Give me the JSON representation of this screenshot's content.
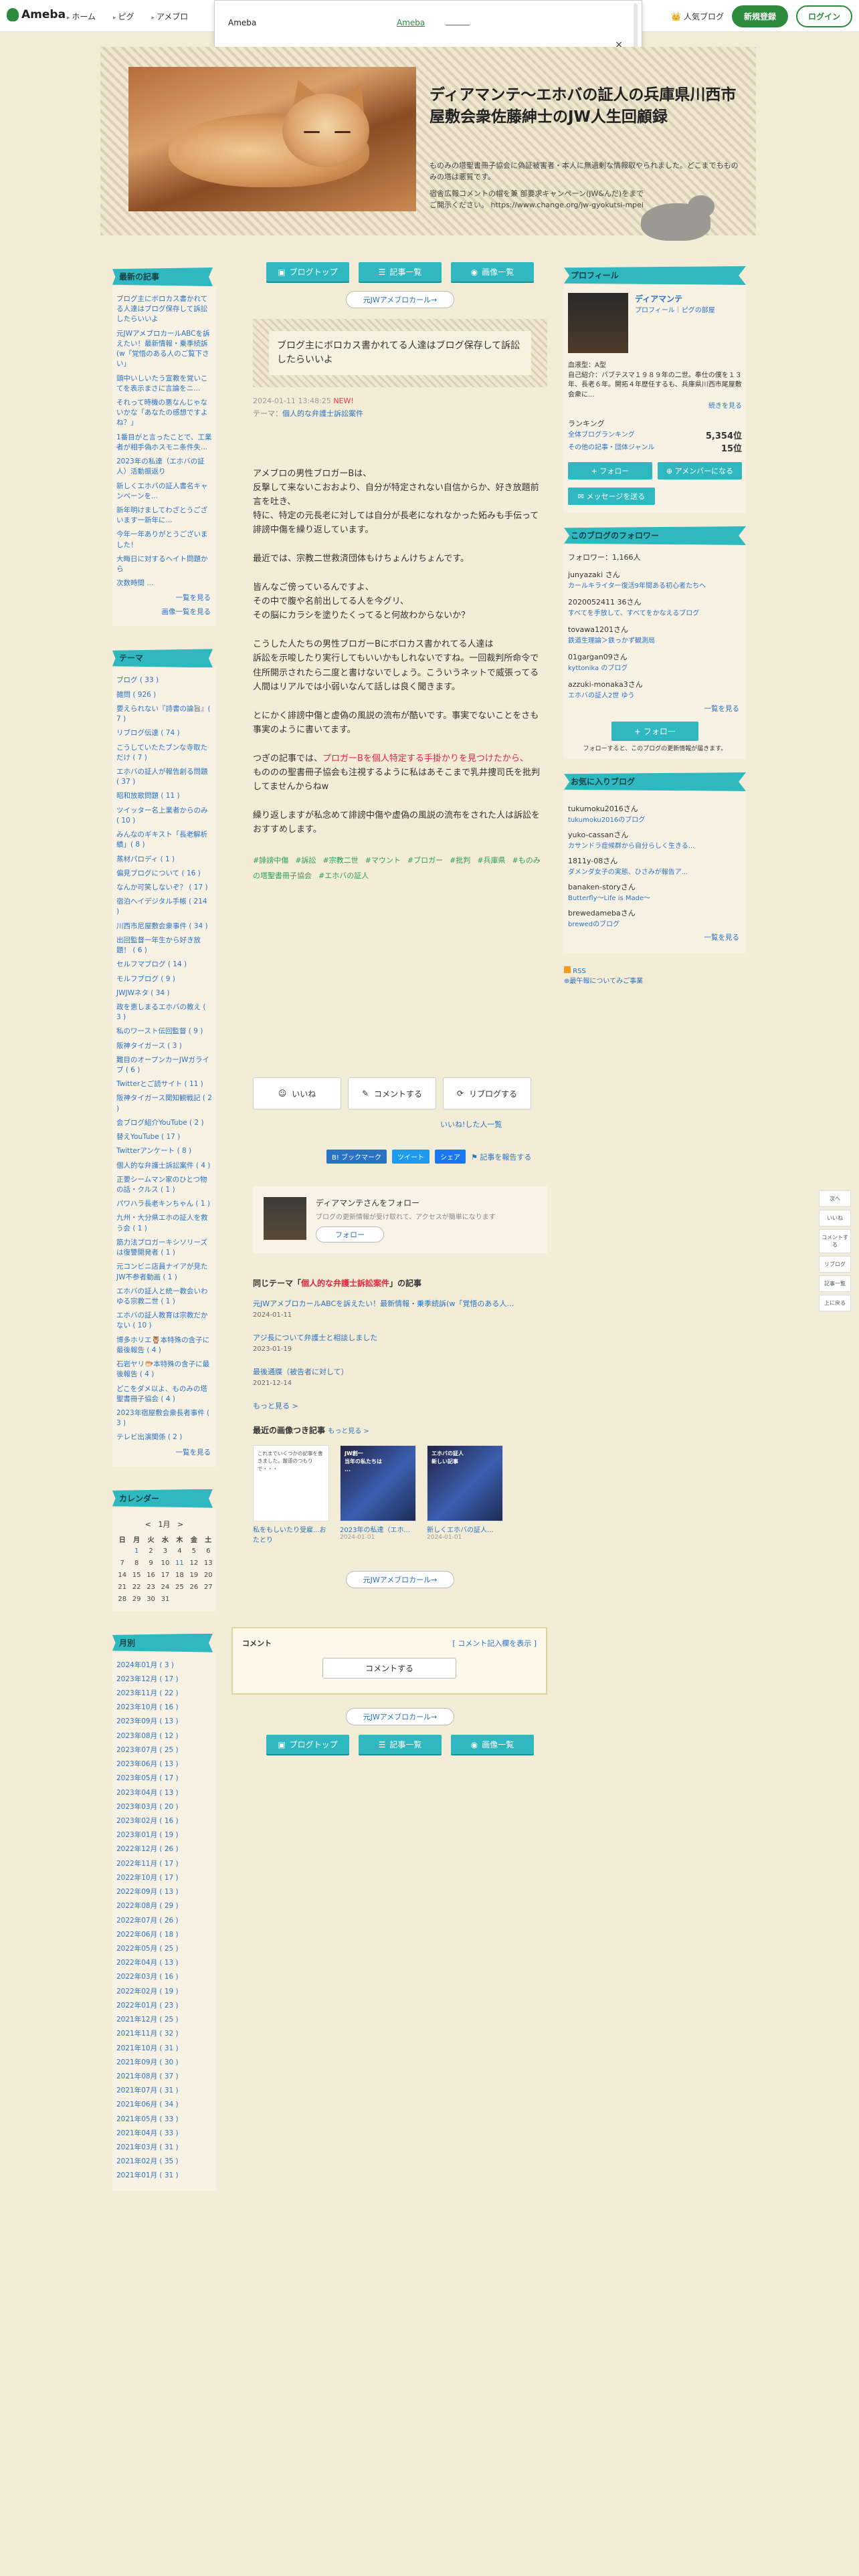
{
  "topbar": {
    "logo": "Ameba",
    "nav": [
      "ホーム",
      "ピグ",
      "アメブロ"
    ],
    "popular": "人気ブログ",
    "register": "新規登録",
    "login": "ログイン"
  },
  "popup": {
    "title": "Ameba",
    "link": "Ameba",
    "close": "×"
  },
  "header": {
    "title": "ディアマンテ〜エホバの証人の兵庫県川西市屋敷会衆佐藤紳士のJW人生回顧録",
    "desc": "ものみの塔聖書冊子協会に偽証被害者・本人に無過剰な情報取やられました。どこまでもものみの塔は悪質です。",
    "desc2": "宿舎広報コメントの帽を兼 部要求キャンペーン(JW&んだ)をまでご開示ください。 https://www.change.org/jw-gyokutsi-mpei"
  },
  "nav_buttons": [
    "ブログトップ",
    "記事一覧",
    "画像一覧"
  ],
  "pill_link": "元JWアメブロカール→",
  "article": {
    "title": "ブログ主にボロカス書かれてる人達はブログ保存して訴訟したらいいよ",
    "date": "2024-01-11 13:48:25",
    "new": "NEW!",
    "theme_prefix": "テーマ：",
    "theme": "個人的な弁護士訴訟案件",
    "paragraphs": [
      "アメブロの男性ブロガーBは、\n反撃して来ないこおおより、自分が特定されない自信からか、好き放題前言を吐き、\n特に、特定の元長老に対しては自分が長老になれなかった妬みも手伝って誹謗中傷を繰り返しています。",
      "最近では、宗教二世救済団体もけちょんけちょんです。",
      "皆んなご傍っているんですよ、\nその中で腹や名前出してる人を今グリ、\nその脳にカラシを塗りたくってると何故わからないか？",
      "こうした人たちの男性ブロガーBにボロカス書かれてる人達は\n訴訟を示唆したり実行してもいいかもしれないですね。一回裁判所命令で住所開示されたら二度と書けないでしょう。こういうネットで威張ってる人間はリアルでは小弱いなんて話しは良く聞きます。",
      "とにかく誹謗中傷と虚偽の風説の流布が酷いです。事実でないことをさも事実のように書いてます。",
      "つぎの記事では、プロガーBを個人特定する手掛かりを見つけたから、\nもののの聖書冊子協会も注視するように私はあそこまで乳井捜司氏を批判してませんからねw",
      "繰り返しますが私念めて誹謗中傷や虚偽の風説の流布をされた人は訴訟をおすすめします。"
    ],
    "red_phrase": "プロガーBを個人特定する手掛かりを見つけたから、",
    "hashtags": [
      "#誹謗中傷",
      "#訴訟",
      "#宗教二世",
      "#マウント",
      "#ブロガー",
      "#批判",
      "#兵庫県",
      "#ものみの塔聖書冊子協会",
      "#エホバの証人"
    ]
  },
  "reactions": {
    "like": "いいね",
    "comment": "コメントする",
    "reblog": "リブログする"
  },
  "share": {
    "liked_by": "いいね!した人一覧",
    "hatena": "B! ブックマーク",
    "tweet": "ツイート",
    "fb": "シェア",
    "report": "記事を報告する"
  },
  "follow_box": {
    "title": "ディアマンテさんをフォロー",
    "sub": "ブログの更新情報が受け取れて、アクセスが簡単になります",
    "button": "フォロー"
  },
  "same_theme": {
    "label_pre": "同じテーマ「",
    "theme": "個人的な弁護士訴訟案件",
    "label_post": "」の記事",
    "items": [
      {
        "title": "元JWアメブロカールABCを訴えたい！最新情報・乗季続訴(w「覚悟のある人…",
        "date": "2024-01-11"
      },
      {
        "title": "アジ長について弁護士と相談しました",
        "date": "2023-01-19"
      },
      {
        "title": "最後通牒（被告者に対して）",
        "date": "2021-12-14"
      }
    ],
    "more": "もっと見る >"
  },
  "recent": {
    "title": "最近の画像つき記事",
    "more": "もっと見る >",
    "items": [
      {
        "text": "これまでいくつかの記事を書きました。報道のつもりで・・・",
        "caption": "私をもしいたり受雇...おたとり",
        "date": "",
        "blue": false
      },
      {
        "text": "JW創一\n当年の私たちは\n...",
        "caption": "2023年の私達（エホ...",
        "date": "2024-01-01",
        "blue": true
      },
      {
        "text": "エホバの証人\n新しい記事",
        "caption": "新しくエホバの証人...",
        "date": "2024-01-01",
        "blue": true
      }
    ]
  },
  "comment_box": {
    "title": "コメント",
    "link": "[ コメント記入欄を表示 ]",
    "button": "コメントする"
  },
  "left": {
    "recent_title": "最新の記事",
    "recent_articles": [
      "ブログ主にボロカス書かれてる人達はブログ保存して訴訟したらいいよ",
      "元JWアメブロカールABCを訴えたい！最新情報・乗季続訴(w「覚悟のある人のご覧下さい」",
      "頭中いしいたう宣教を覚いこてを表示まさに言論をニ...",
      "それって時機の悪なんじゃないかな「あなたの感想ですよね？」",
      "1番目がと言ったことで、工業者が相手偽ホスモニ条件失...",
      "2023年の私達（エホバの証人）活動振返り",
      "新しくエホバの証人書名キャンペーンを...",
      "新年明けましてわざとうございます一新年に...",
      "今年一年ありがとうございました！",
      "大晦日に対するヘイト問題から",
      "次数時間 ..."
    ],
    "recent_more": "一覧を見る",
    "image_list": "画像一覧を見る",
    "theme_title": "テーマ",
    "themes": [
      "ブログ ( 33 )",
      "雑問 ( 926 )",
      "要えられない『詩書の論旨』( 7 )",
      "リブログ伝達 ( 74 )",
      "こうしていたたブンな寺取ただけ ( 7 )",
      "エホバの証人が報告創る問題 ( 37 )",
      "昭和放歌問題 ( 11 )",
      "ツイッター名上業者からのみ ( 10 )",
      "みんなのギキスト「長老解析績」( 8 )",
      "蒸材パロディ ( 1 )",
      "偏見ブログについて ( 16 )",
      "なんか可笑しないぞ？ ( 17 )",
      "宿泊ヘイデジタル手帳 ( 214 )",
      "川西市尼屋敷会衆事件 ( 34 )",
      "出回監督一年生から好き放題！ ( 6 )",
      "セルフマブログ ( 14 )",
      "モルフブログ ( 9 )",
      "JWJWネタ ( 34 )",
      "政を恵しまるエホバの教え ( 3 )",
      "私のワースト伝回監督 ( 9 )",
      "阪神タイガース ( 3 )",
      "難目のオープンカーJWガライブ ( 6 )",
      "Twitterとご読サイト ( 11 )",
      "阪神タイガース関知観戦記 ( 2 )",
      "会ブログ紹介YouTube ( 2 )",
      "替えYouTube ( 17 )",
      "Twitterアンケート ( 8 )",
      "個人的な弁護士訴訟案件 ( 4 )",
      "正要シームマン家のひとつ物の話・クルス ( 1 )",
      "パワハラ長老キンちゃん ( 1 )",
      "九州・大分県エホの証人を救う会 ( 1 )",
      "筋力法ブロガーキシソリーズは復讐開発者 ( 1 )",
      "元コンビニ店員ナイアが見たJW不参者動画 ( 1 )",
      "エホバの証人と統一教会いわゆる宗教二世 ( 1 )",
      "エホバの証人教育は宗教だかない ( 10 )",
      "博多ホリエ🦉本特殊の含子に最後報告 ( 4 )",
      "石岩ヤリ🐡本特殊の含子に最後報告 ( 4 )",
      "どこをダメ以よ、ものみの塔聖書冊子協会 ( 4 )",
      "2023年宿屋敷会衆長者事件 ( 3 )",
      "テレビ出演関係 ( 2 )"
    ],
    "themes_more": "一覧を見る",
    "calendar_title": "カレンダー",
    "calendar_month": "1月",
    "calendar_prev": "<",
    "calendar_next": ">",
    "weekdays": [
      "日",
      "月",
      "火",
      "水",
      "木",
      "金",
      "土"
    ],
    "calendar_rows": [
      [
        "",
        "1",
        "2",
        "3",
        "4",
        "5",
        "6"
      ],
      [
        "7",
        "8",
        "9",
        "10",
        "11",
        "12",
        "13"
      ],
      [
        "14",
        "15",
        "16",
        "17",
        "18",
        "19",
        "20"
      ],
      [
        "21",
        "22",
        "23",
        "24",
        "25",
        "26",
        "27"
      ],
      [
        "28",
        "29",
        "30",
        "31",
        "",
        "",
        ""
      ]
    ],
    "calendar_links": [
      "1",
      "11"
    ],
    "month_title": "月別",
    "months": [
      "2024年01月 ( 3 )",
      "2023年12月 ( 17 )",
      "2023年11月 ( 22 )",
      "2023年10月 ( 16 )",
      "2023年09月 ( 13 )",
      "2023年08月 ( 12 )",
      "2023年07月 ( 25 )",
      "2023年06月 ( 13 )",
      "2023年05月 ( 17 )",
      "2023年04月 ( 13 )",
      "2023年03月 ( 20 )",
      "2023年02月 ( 16 )",
      "2023年01月 ( 19 )",
      "2022年12月 ( 26 )",
      "2022年11月 ( 17 )",
      "2022年10月 ( 17 )",
      "2022年09月 ( 13 )",
      "2022年08月 ( 29 )",
      "2022年07月 ( 26 )",
      "2022年06月 ( 18 )",
      "2022年05月 ( 25 )",
      "2022年04月 ( 13 )",
      "2022年03月 ( 16 )",
      "2022年02月 ( 19 )",
      "2022年01月 ( 23 )",
      "2021年12月 ( 25 )",
      "2021年11月 ( 32 )",
      "2021年10月 ( 31 )",
      "2021年09月 ( 30 )",
      "2021年08月 ( 37 )",
      "2021年07月 ( 31 )",
      "2021年06月 ( 34 )",
      "2021年05月 ( 33 )",
      "2021年04月 ( 33 )",
      "2021年03月 ( 31 )",
      "2021年02月 ( 35 )",
      "2021年01月 ( 31 )"
    ]
  },
  "right": {
    "profile_title": "プロフィール",
    "name": "ディアマンテ",
    "profile_sub": "プロフィール｜ピグの部屋",
    "profile_desc": "血液型：A型\n自己紹介：バブテスマ１９８９年の二世。奉仕の僕を１３年、長老６年。開拓４年歴任するも、兵庫県川西市尾屋敷会衆に...",
    "profile_more": "続きを見る",
    "ranking_title": "ランキング",
    "rank1_label": "全体ブログランキング",
    "rank1": "5,354位",
    "rank2_label": "その他の記事・団体ジャンル",
    "rank2": "15位",
    "follow": "フォロー",
    "member": "アメンバーになる",
    "message": "メッセージを送る",
    "followers_title": "このブログのフォロワー",
    "followers_count": "フォロワー：1,166人",
    "followers": [
      {
        "name": "junyazaki さん",
        "title": "カールキライター復活9年間ある初心者たちへ"
      },
      {
        "name": "2020052411 36さん",
        "title": "すべてを手放して、すべてをかなえるブログ"
      },
      {
        "name": "tovawa1201さん",
        "title": "鉄道生理論＞鉄っかず観測局"
      },
      {
        "name": "01gargan09さん",
        "title": "kyttonika のブログ"
      },
      {
        "name": "azzuki-monaka3さん",
        "title": "エホバの証人2世 ゆう"
      }
    ],
    "followers_more": "一覧を見る",
    "follow_big": "フォロー",
    "follow_note": "フォローすると、このブログの更新情報が届きます。",
    "favs_title": "お気に入りブログ",
    "favs": [
      {
        "name": "tukumoku2016さん",
        "title": "tukumoku2016のブログ"
      },
      {
        "name": "yuko-cassanさん",
        "title": "カサンドラ症候群から自分らしく生きる..."
      },
      {
        "name": "1811y-08さん",
        "title": "ダメンダ女子の実態、ひさみが報告ア..."
      },
      {
        "name": "banaken-storyさん",
        "title": "Butterfly〜Life is Made〜"
      },
      {
        "name": "brewedamebaさん",
        "title": "brewedのブログ"
      }
    ],
    "favs_more": "一覧を見る",
    "rss": "RSS",
    "rss_sub": "⊕最午報についてみご事業"
  },
  "sidetools": [
    "次へ",
    "いいね",
    "コメントする",
    "リブログ",
    "記事一覧",
    "上に戻る"
  ]
}
